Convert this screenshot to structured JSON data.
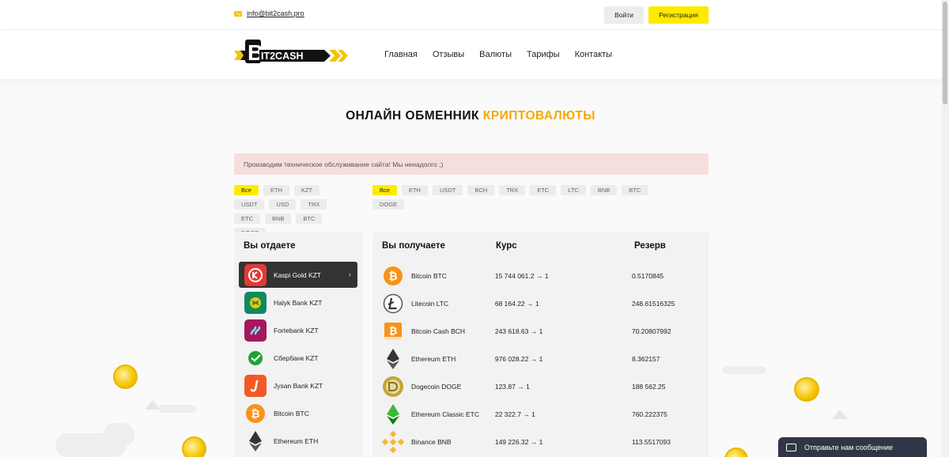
{
  "topbar": {
    "email": "info@bit2cash.pro",
    "login_label": "Войти",
    "register_label": "Регистрация"
  },
  "logo": {
    "text": "BIT2CASH"
  },
  "nav": [
    "Главная",
    "Отзывы",
    "Валюты",
    "Тарифы",
    "Контакты"
  ],
  "hero": {
    "title_main": "ОНЛАЙН ОБМЕННИК ",
    "title_accent": "КРИПТОВАЛЮТЫ",
    "accent_color": "#f5a800"
  },
  "notice": "Производим техническое обслуживание сайта! Мы ненадолго ;)",
  "filters_give": [
    "Все",
    "ETH",
    "KZT",
    "USDT",
    "USD",
    "TRX",
    "ETC",
    "BNB",
    "BTC",
    "DOGE"
  ],
  "filters_get": [
    "Все",
    "ETH",
    "USDT",
    "BCH",
    "TRX",
    "ETC",
    "LTC",
    "BNB",
    "BTC",
    "DOGE"
  ],
  "give": {
    "header": "Вы отдаете",
    "items": [
      {
        "label": "Kaspi Gold KZT",
        "icon": "kaspi-icon",
        "active": true
      },
      {
        "label": "Halyk Bank KZT",
        "icon": "halyk-icon"
      },
      {
        "label": "Fortebank KZT",
        "icon": "forte-icon"
      },
      {
        "label": "Сбербанк KZT",
        "icon": "sber-icon"
      },
      {
        "label": "Jysan Bank KZT",
        "icon": "jysan-icon"
      },
      {
        "label": "Bitcoin BTC",
        "icon": "bitcoin-icon"
      },
      {
        "label": "Ethereum ETH",
        "icon": "ethereum-icon"
      }
    ]
  },
  "get": {
    "header_receive": "Вы получаете",
    "header_rate": "Курс",
    "header_reserve": "Резерв",
    "rows": [
      {
        "name": "Bitcoin BTC",
        "rate": "15 744 061.2 → 1",
        "reserve": "0.5170845",
        "icon": "bitcoin-icon"
      },
      {
        "name": "Litecoin LTC",
        "rate": "68 164.22 → 1",
        "reserve": "248.61516325",
        "icon": "litecoin-icon"
      },
      {
        "name": "Bitcoin Cash BCH",
        "rate": "243 618.63 → 1",
        "reserve": "70.20807992",
        "icon": "bitcoin-cash-icon"
      },
      {
        "name": "Ethereum ETH",
        "rate": "976 028.22 → 1",
        "reserve": "8.362157",
        "icon": "ethereum-icon"
      },
      {
        "name": "Dogecoin DOGE",
        "rate": "123.87 → 1",
        "reserve": "188 562.25",
        "icon": "dogecoin-icon"
      },
      {
        "name": "Ethereum Classic ETC",
        "rate": "22 322.7 → 1",
        "reserve": "760.222375",
        "icon": "ethereum-classic-icon"
      },
      {
        "name": "Binance BNB",
        "rate": "149 226.32 → 1",
        "reserve": "113.5517093",
        "icon": "binance-icon"
      }
    ]
  },
  "chat": {
    "label": "Отправьте нам сообщение"
  }
}
